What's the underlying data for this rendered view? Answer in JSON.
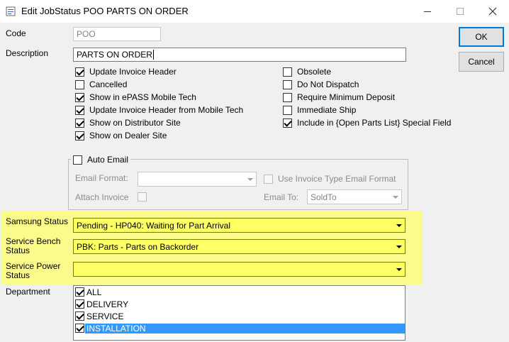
{
  "window": {
    "title": "Edit JobStatus POO PARTS ON ORDER",
    "controls": {
      "minimize": "minimize-icon",
      "maximize": "maximize-icon",
      "close": "close-icon"
    }
  },
  "buttons": {
    "ok": "OK",
    "cancel": "Cancel"
  },
  "code": {
    "label": "Code",
    "value": "POO"
  },
  "description": {
    "label": "Description",
    "value": "PARTS ON ORDER"
  },
  "checks_left": [
    {
      "label": "Update Invoice Header",
      "checked": true
    },
    {
      "label": "Cancelled",
      "checked": false
    },
    {
      "label": "Show in ePASS Mobile Tech",
      "checked": true
    },
    {
      "label": "Update Invoice Header from Mobile Tech",
      "checked": true
    },
    {
      "label": "Show on Distributor Site",
      "checked": true
    },
    {
      "label": "Show on Dealer Site",
      "checked": true
    }
  ],
  "checks_right": [
    {
      "label": "Obsolete",
      "checked": false
    },
    {
      "label": "Do Not Dispatch",
      "checked": false
    },
    {
      "label": "Require Minimum Deposit",
      "checked": false
    },
    {
      "label": "Immediate Ship",
      "checked": false
    },
    {
      "label": "Include in {Open Parts List} Special Field",
      "checked": true
    }
  ],
  "auto_email": {
    "label": "Auto Email",
    "checked": false,
    "email_format_label": "Email Format:",
    "email_format_value": "",
    "use_invoice_type_label": "Use Invoice Type Email Format",
    "use_invoice_type_checked": false,
    "attach_invoice_label": "Attach Invoice",
    "attach_invoice_checked": false,
    "email_to_label": "Email To:",
    "email_to_value": "SoldTo"
  },
  "samsung_status": {
    "label": "Samsung Status",
    "value": "Pending - HP040: Waiting for Part Arrival"
  },
  "service_bench_status": {
    "label_line1": "Service Bench",
    "label_line2": "Status",
    "value": "PBK: Parts - Parts on Backorder"
  },
  "service_power_status": {
    "label_line1": "Service Power",
    "label_line2": "Status",
    "value": ""
  },
  "department": {
    "label": "Department",
    "items": [
      {
        "label": "ALL",
        "checked": true
      },
      {
        "label": "DELIVERY",
        "checked": true
      },
      {
        "label": "SERVICE",
        "checked": true
      },
      {
        "label": "INSTALLATION",
        "checked": true
      }
    ]
  },
  "colors": {
    "highlight": "#fbfb8c",
    "combo_highlight": "#ffff66",
    "selection": "#3399ff",
    "default_button_border": "#0078d7"
  }
}
